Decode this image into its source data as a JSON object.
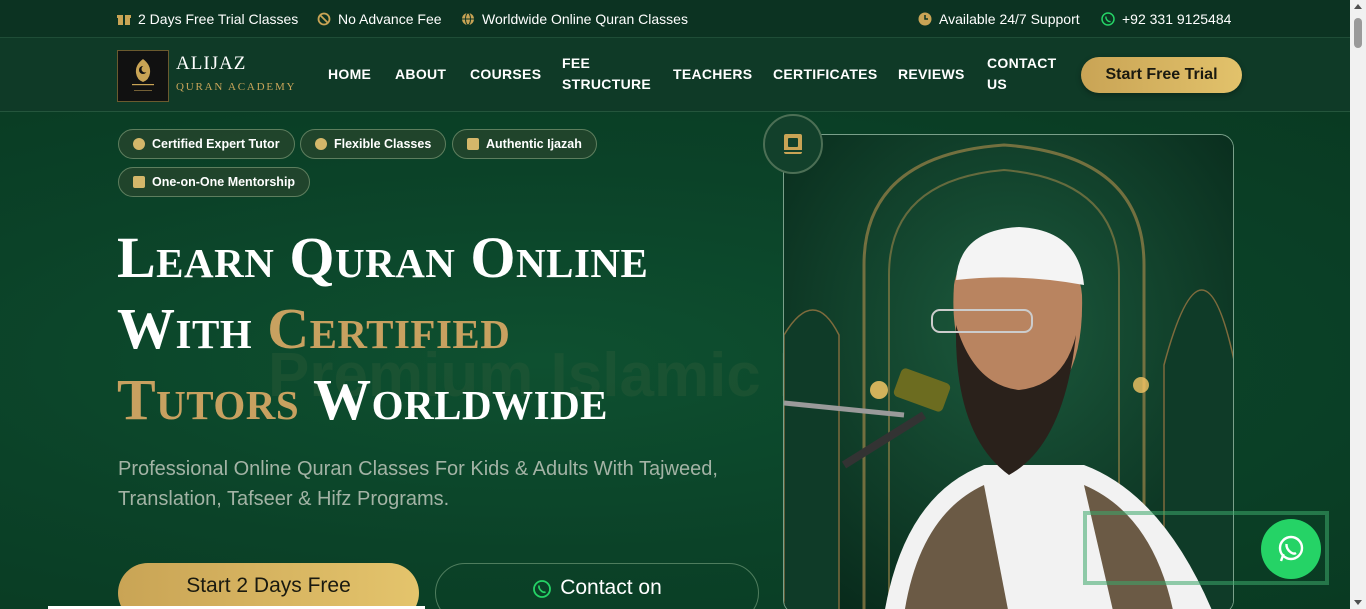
{
  "topbar": {
    "trial": "2 Days Free Trial Classes",
    "no_fee": "No Advance Fee",
    "worldwide": "Worldwide Online Quran Classes",
    "support": "Available 24/7 Support",
    "phone": "+92 331 9125484"
  },
  "brand": {
    "name": "ALIJAZ",
    "tagline": "QURAN ACADEMY",
    "logo_text": "ALIJAZ"
  },
  "nav": {
    "home": "HOME",
    "about": "ABOUT",
    "courses": "COURSES",
    "fee_1": "FEE",
    "fee_2": "STRUCTURE",
    "teachers": "TEACHERS",
    "certificates": "CERTIFICATES",
    "reviews": "REVIEWS",
    "contact_1": "CONTACT",
    "contact_2": "US",
    "cta": "Start Free Trial"
  },
  "hero": {
    "badges": [
      "Certified Expert Tutor",
      "Flexible Classes",
      "Authentic Ijazah",
      "One-on-One Mentorship"
    ],
    "ghost_text": "Premium Islamic B",
    "headline": {
      "line1": "Learn Quran Online",
      "line2_white": "With",
      "line2_gold": "Certified",
      "line3_gold": "Tutors",
      "line3_white": "Worldwide"
    },
    "subtext": "Professional Online Quran Classes For Kids & Adults With Tajweed, Translation, Tafseer & Hifz Programs.",
    "primary_button": "Start 2 Days Free",
    "secondary_button": "Contact on"
  },
  "colors": {
    "gold": "#c8a160",
    "dark_green": "#0c3322",
    "whatsapp": "#25d366"
  },
  "icons": [
    "gift-icon",
    "no-fee-icon",
    "globe-icon",
    "clock-icon",
    "whatsapp-icon",
    "book-icon"
  ]
}
